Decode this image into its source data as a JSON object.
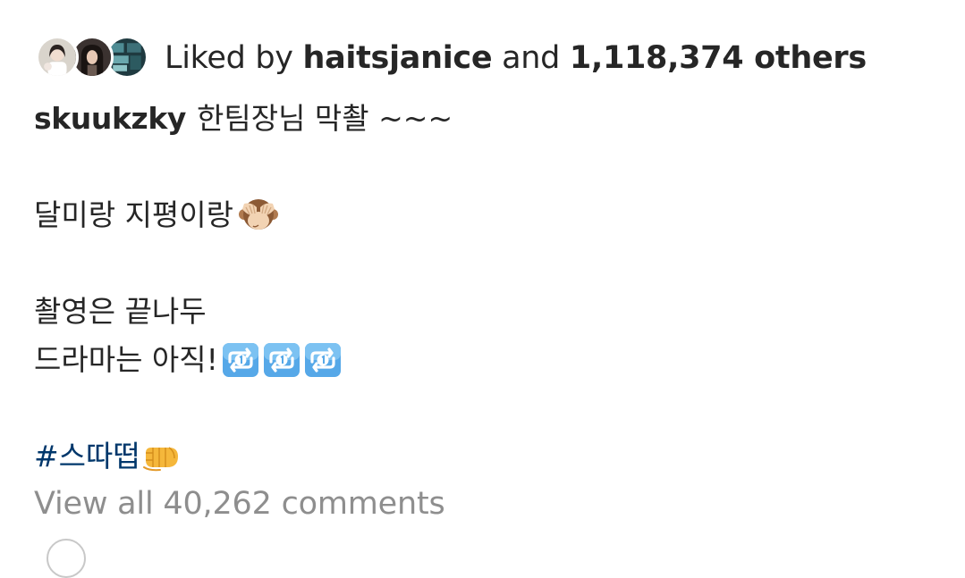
{
  "likes": {
    "prefix": "Liked by",
    "first_liker": "haitsjanice",
    "connector": "and",
    "others_count": "1,118,374 others",
    "avatars": [
      "liker-avatar-1",
      "liker-avatar-2",
      "liker-avatar-3"
    ]
  },
  "caption": {
    "username": "skuukzky",
    "line1": "한팀장님 막촬 ~~~",
    "line2": "달미랑 지평이랑",
    "line2_emoji": "see-no-evil-monkey-icon",
    "line3": "촬영은 끝나두",
    "line4": "드라마는 아직!",
    "line4_emoji": "repeat-one-icon",
    "hashtag": "#스따떱",
    "hashtag_emoji": "left-facing-fist-icon"
  },
  "comments": {
    "view_all": "View all 40,262 comments"
  },
  "colors": {
    "text": "#262626",
    "muted": "#8e8e8e",
    "hashtag": "#00376b"
  }
}
